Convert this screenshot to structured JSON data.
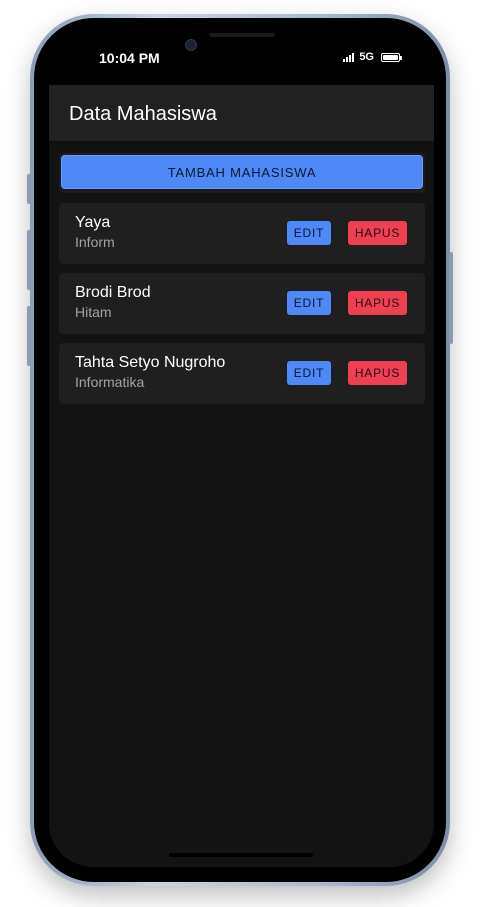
{
  "status_bar": {
    "time": "10:04 PM",
    "network": "5G",
    "icons": [
      "signal-icon",
      "battery-icon"
    ]
  },
  "app": {
    "title": "Data Mahasiswa"
  },
  "actions": {
    "add_label": "TAMBAH MAHASISWA"
  },
  "students": [
    {
      "name": "Yaya",
      "major": "Inform",
      "edit_label": "EDIT",
      "delete_label": "HAPUS"
    },
    {
      "name": "Brodi Brod",
      "major": "Hitam",
      "edit_label": "EDIT",
      "delete_label": "HAPUS"
    },
    {
      "name": "Tahta Setyo Nugroho",
      "major": "Informatika",
      "edit_label": "EDIT",
      "delete_label": "HAPUS"
    }
  ],
  "colors": {
    "primary": "#4f89f7",
    "danger": "#ee4053",
    "background": "#131313",
    "card": "#1f1f1f",
    "appbar": "#212121"
  }
}
